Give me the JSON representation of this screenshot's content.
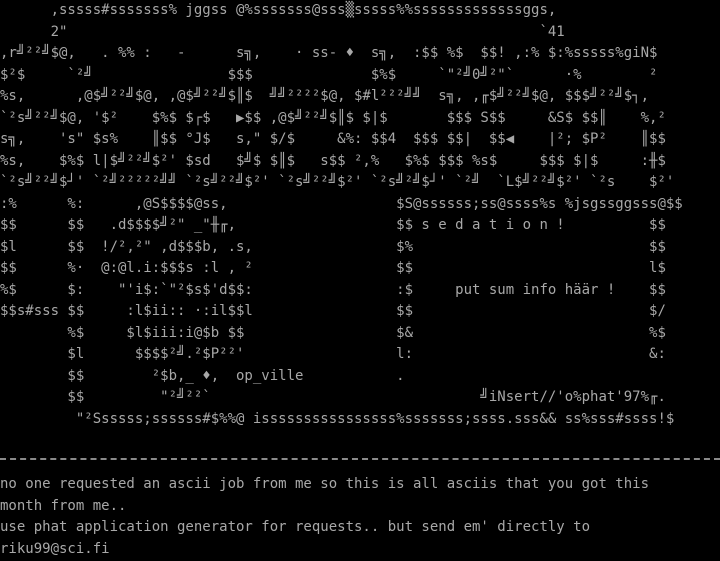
{
  "art_lines": [
    "      ,sssss#sssssss% jggss @%sssssss@sss▒sssss%%sssssssssssssggs,",
    "      2\"                                                        `41",
    ",r╝²²╝$@,   . %% :   -      s╗,    · ss- ♦  s╗,  :$$ %$  $$! ,:% $:%sssss%giN$",
    "$²$     `²╝                $$$              $%$     `\"²╝0╝²\"`      ·%        ²",
    "%s,      ,@$╝²²╝$@, ,@$╝²²╝$║$  ╝╝²²²²$@, $#l²²²╝╝  s╗, ,╓$╝²²╝$@, $$$╝²²╝$┐,",
    "`²s╝²²╝$@, '$²    $%$ $┌$   ▶$$ ,@$╝²²╝$║$ $|$       $$$ S$$     &S$ $$║    %,²",
    "s╗,    's\" $s%    ║$$ °J$   s,\" $/$     &%: $$4  $$$ $$|  $$◀    |²; $P²    ║$$",
    "%s,    $%$ l|$╝²²╝$²' $sd   $╝$ $║$   s$$ ²,%   $%$ $$$ %s$     $$$ $|$     :╫$",
    "`²s╝²²╝$┘' `²╝²²²²²╝╝ `²s╝²²╝$²' `²s╝²²╝$²' `²s╝²╝$┘' `²╝  `L$╝²²╝$²' `²s    $²'",
    ":%      %:      ,@S$$$$@ss,                    $S@ssssss;ss@ssss%s %jsgssggsss@$$",
    "$$      $$   .d$$$$╝²\" _\"╫╓,                   $$ s e d a t i o n !          $$",
    "$l      $$  !/²,²\" ,d$$$b, .s,                 $%                            $$",
    "$$      %·  @:@l.i:$$$s :l , ²                 $$                            l$",
    "%$      $:    \"'i$:`\"²$s$'d$$:                 :$     put sum info häär !    $$",
    "$$s#sss $$     :l$ii:: ·:il$$l                 $$                            $/",
    "        %$     $l$iii:i@$b $$                  $&                            %$",
    "        $l      $$$$²╝.²$P²²'                  l:                            &:",
    "        $$        ²$b,_ ♦,  op_ville           .                             ",
    "        $$         \"²╝²²`                                ╝iNsert//'o%phat'97%╓.",
    "         \"²Ssssss;ssssss#$%%@ issssssssssssssss%sssssss;ssss.sss&& ss%sss#ssss!$"
  ],
  "message_lines": [
    "no one requested an ascii job from me so this is all asciis that you got this",
    "month from me..",
    "use phat application generator for requests.. but send em' directly to",
    "riku99@sci.fi"
  ]
}
